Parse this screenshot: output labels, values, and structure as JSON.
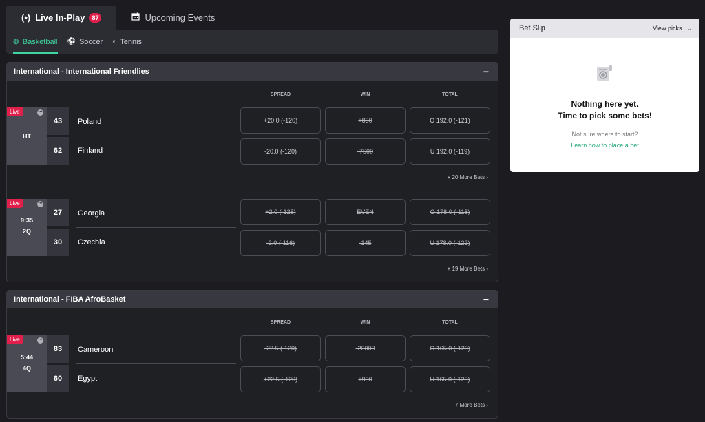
{
  "top_tabs": [
    {
      "label": "Live In-Play",
      "badge": "87",
      "icon": "live-broadcast-icon",
      "active": true
    },
    {
      "label": "Upcoming Events",
      "icon": "calendar-icon",
      "active": false
    }
  ],
  "sport_tabs": [
    {
      "label": "Basketball",
      "icon": "basketball-icon",
      "active": true
    },
    {
      "label": "Soccer",
      "icon": "soccer-ball-icon",
      "active": false
    },
    {
      "label": "Tennis",
      "icon": "tennis-ball-icon",
      "active": false
    }
  ],
  "columns": {
    "spread": "SPREAD",
    "win": "WIN",
    "total": "TOTAL"
  },
  "leagues": [
    {
      "title": "International - International Friendlies",
      "collapse": "−",
      "matches": [
        {
          "live": "Live",
          "clock": [
            "HT"
          ],
          "teams": [
            {
              "name": "Poland",
              "score": "43",
              "spread": "+20.0 (-120)",
              "win": "+850",
              "total": "O 192.0 (-121)"
            },
            {
              "name": "Finland",
              "score": "62",
              "spread": "-20.0 (-120)",
              "win": "-7500",
              "total": "U 192.0 (-119)"
            }
          ],
          "more": "+ 20 More Bets ›"
        },
        {
          "live": "Live",
          "clock": [
            "9:35",
            "2Q"
          ],
          "teams": [
            {
              "name": "Georgia",
              "score": "27",
              "spread": "+2.0 (-125)",
              "win": "EVEN",
              "total": "O 178.0 (-118)"
            },
            {
              "name": "Czechia",
              "score": "30",
              "spread": "-2.0 (-116)",
              "win": "-145",
              "total": "U 178.0 (-122)"
            }
          ],
          "more": "+ 19 More Bets ›"
        }
      ]
    },
    {
      "title": "International - FIBA AfroBasket",
      "collapse": "−",
      "matches": [
        {
          "live": "Live",
          "clock": [
            "5:44",
            "4Q"
          ],
          "teams": [
            {
              "name": "Cameroon",
              "score": "83",
              "spread": "-22.5 (-120)",
              "win": "-20000",
              "total": "O 165.0 (-120)"
            },
            {
              "name": "Egypt",
              "score": "60",
              "spread": "+22.5 (-120)",
              "win": "+900",
              "total": "U 165.0 (-120)"
            }
          ],
          "more": "+ 7 More Bets ›"
        }
      ]
    }
  ],
  "bet_slip": {
    "title": "Bet Slip",
    "view_picks": "View picks",
    "empty_line1": "Nothing here yet.",
    "empty_line2": "Time to pick some bets!",
    "hint": "Not sure where to start?",
    "link": "Learn how to place a bet",
    "icon": "bet-ticket-add-icon"
  },
  "colors": {
    "accent": "#3fd4a0",
    "live": "#e0204a",
    "link": "#21a57a"
  }
}
